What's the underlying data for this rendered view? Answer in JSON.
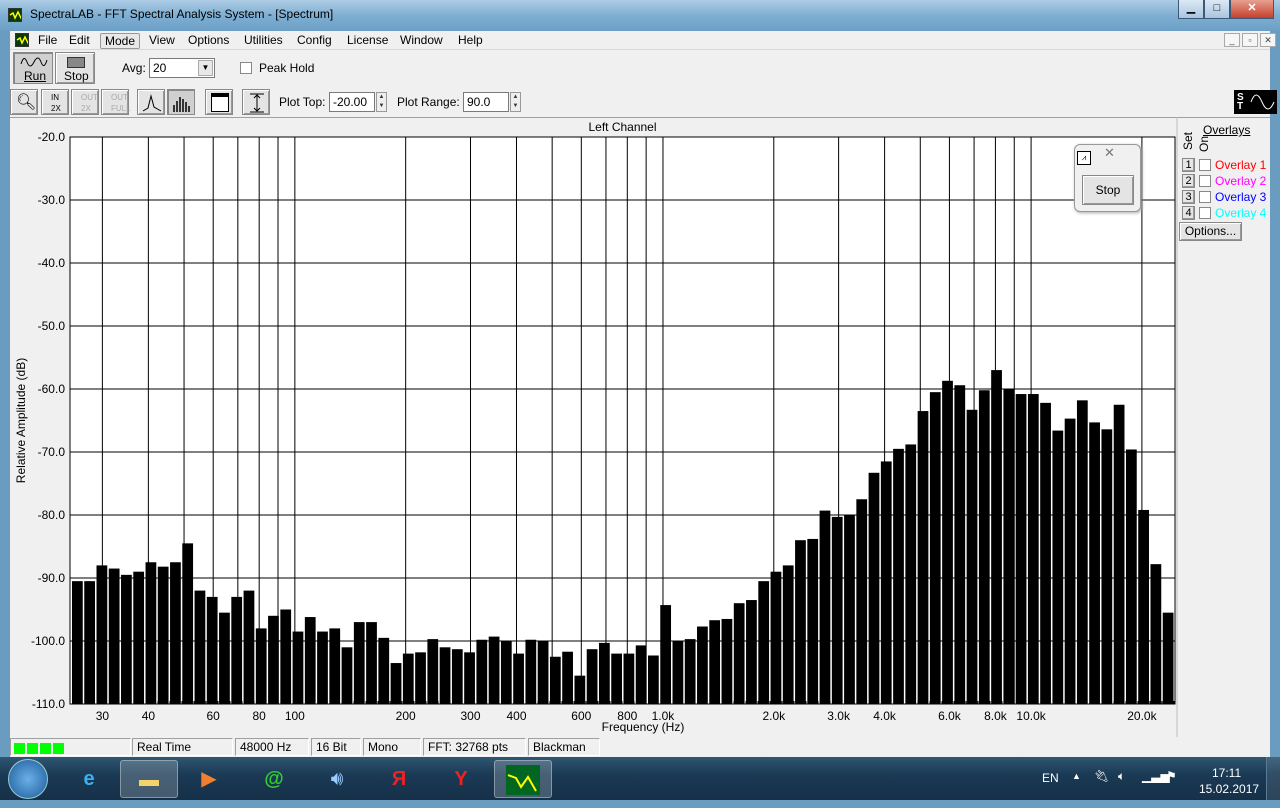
{
  "window": {
    "title": "SpectraLAB - FFT Spectral Analysis System - [Spectrum]",
    "min": "▁",
    "max": "□",
    "close": "✕"
  },
  "menu": [
    "File",
    "Edit",
    "Mode",
    "View",
    "Options",
    "Utilities",
    "Config",
    "License",
    "Window",
    "Help"
  ],
  "mdi_controls": [
    "_",
    "▫",
    "✕"
  ],
  "toolbar": {
    "run_label": "Run",
    "stop_label": "Stop",
    "avg_label": "Avg:",
    "avg_value": "20",
    "peak_hold_label": "Peak Hold",
    "peak_hold_checked": false,
    "zoom_in_label": "IN 2X",
    "zoom_out_label": "OUT 2X",
    "zoom_full_label": "OUT FULL",
    "plot_top_label": "Plot Top:",
    "plot_top_value": "-20.00",
    "plot_range_label": "Plot Range:",
    "plot_range_value": "90.0",
    "st_label": "S T"
  },
  "float_panel": {
    "stop_label": "Stop"
  },
  "overlays": {
    "title": "Overlays",
    "set_label": "Set",
    "on_label": "On",
    "options_label": "Options...",
    "items": [
      {
        "num": "1",
        "label": "Overlay 1",
        "color": "#ff0000"
      },
      {
        "num": "2",
        "label": "Overlay 2",
        "color": "#ff00ff"
      },
      {
        "num": "3",
        "label": "Overlay 3",
        "color": "#0000ff"
      },
      {
        "num": "4",
        "label": "Overlay 4",
        "color": "#00ffff"
      }
    ]
  },
  "chart_data": {
    "type": "bar",
    "title": "Left Channel",
    "xlabel": "Frequency (Hz)",
    "ylabel": "Relative Amplitude (dB)",
    "xscale": "log",
    "xlim": [
      24.5,
      24600
    ],
    "ylim": [
      -110,
      -20
    ],
    "grid": true,
    "yticks": [
      "-20.0",
      "-30.0",
      "-40.0",
      "-50.0",
      "-60.0",
      "-70.0",
      "-80.0",
      "-90.0",
      "-100.0",
      "-110.0"
    ],
    "xticks": [
      {
        "f": 30,
        "label": "30"
      },
      {
        "f": 40,
        "label": "40"
      },
      {
        "f": 60,
        "label": "60"
      },
      {
        "f": 80,
        "label": "80"
      },
      {
        "f": 100,
        "label": "100"
      },
      {
        "f": 200,
        "label": "200"
      },
      {
        "f": 300,
        "label": "300"
      },
      {
        "f": 400,
        "label": "400"
      },
      {
        "f": 600,
        "label": "600"
      },
      {
        "f": 800,
        "label": "800"
      },
      {
        "f": 1000,
        "label": "1.0k"
      },
      {
        "f": 2000,
        "label": "2.0k"
      },
      {
        "f": 3000,
        "label": "3.0k"
      },
      {
        "f": 4000,
        "label": "4.0k"
      },
      {
        "f": 6000,
        "label": "6.0k"
      },
      {
        "f": 8000,
        "label": "8.0k"
      },
      {
        "f": 10000,
        "label": "10.0k"
      },
      {
        "f": 20000,
        "label": "20.0k"
      }
    ],
    "values": [
      -90.5,
      -90.5,
      -88,
      -88.5,
      -89.5,
      -89,
      -87.5,
      -88.2,
      -87.5,
      -84.5,
      -92,
      -93,
      -95.5,
      -93,
      -92,
      -98,
      -96,
      -95,
      -98.5,
      -96.2,
      -98.5,
      -98,
      -101,
      -97,
      -97,
      -99.5,
      -103.5,
      -102,
      -101.8,
      -99.7,
      -101,
      -101.3,
      -101.8,
      -99.8,
      -99.3,
      -100,
      -102,
      -99.8,
      -100,
      -102.5,
      -101.7,
      -105.5,
      -101.3,
      -100.3,
      -102,
      -102,
      -100.7,
      -102.3,
      -94.3,
      -100,
      -99.7,
      -97.7,
      -96.7,
      -96.5,
      -94,
      -93.5,
      -90.5,
      -89,
      -88,
      -84,
      -83.8,
      -79.3,
      -80.3,
      -80,
      -77.5,
      -73.3,
      -71.5,
      -69.5,
      -68.8,
      -63.5,
      -60.5,
      -58.7,
      -59.4,
      -63.3,
      -60.2,
      -57,
      -60,
      -60.8,
      -60.8,
      -62.2,
      -66.6,
      -64.7,
      -61.8,
      -65.3,
      -66.4,
      -62.5,
      -69.6,
      -79.2,
      -87.8,
      -95.5
    ]
  },
  "status": {
    "level_color": "#00ff00",
    "mode": "Real Time",
    "rate": "48000 Hz",
    "bits": "16 Bit",
    "channels": "Mono",
    "fft": "FFT: 32768 pts",
    "window": "Blackman"
  },
  "taskbar": {
    "lang": "EN",
    "time": "17:11",
    "date": "15.02.2017"
  }
}
